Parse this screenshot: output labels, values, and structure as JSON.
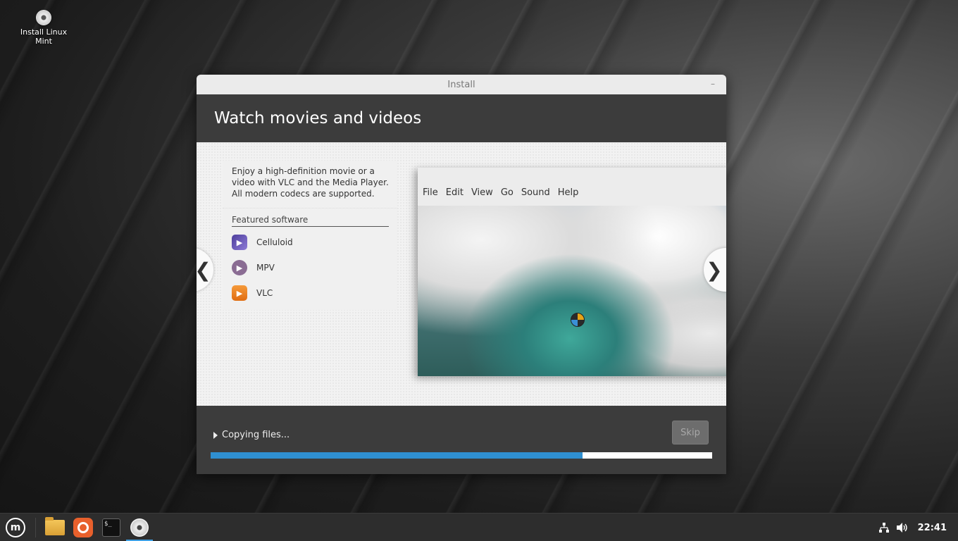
{
  "desktop": {
    "icon_label_line1": "Install Linux",
    "icon_label_line2": "Mint"
  },
  "window": {
    "title": "Install",
    "minimize_symbol": "–",
    "header_title": "Watch movies and videos"
  },
  "slide": {
    "description": "Enjoy a high-definition movie or a video with VLC and the Media Player. All modern codecs are supported.",
    "featured_title": "Featured software",
    "software": [
      {
        "name": "Celluloid",
        "icon": "celluloid-icon"
      },
      {
        "name": "MPV",
        "icon": "mpv-icon"
      },
      {
        "name": "VLC",
        "icon": "vlc-icon"
      }
    ],
    "app_menu": [
      "File",
      "Edit",
      "View",
      "Go",
      "Sound",
      "Help"
    ],
    "prev_arrow": "❮",
    "next_arrow": "❯"
  },
  "progress": {
    "status_text": "Copying files...",
    "skip_label": "Skip",
    "fraction": 0.742,
    "fill_color": "#2f8fd0"
  },
  "taskbar": {
    "apps": [
      "menu-icon",
      "files-icon",
      "firefox-icon",
      "terminal-icon",
      "install-disc-icon"
    ],
    "terminal_glyph": "$_",
    "clock": "22:41"
  }
}
